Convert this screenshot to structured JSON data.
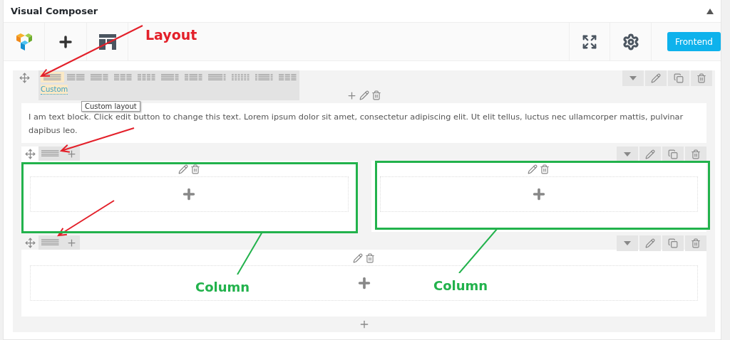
{
  "panel": {
    "title": "Visual Composer",
    "collapsed": false
  },
  "toolbar": {
    "frontend_button": "Frontend"
  },
  "rows": [
    {
      "layout_picker_open": true,
      "layout_options": [
        {
          "selected": true
        },
        {
          "selected": false
        },
        {
          "selected": false
        },
        {
          "selected": false
        },
        {
          "selected": false
        },
        {
          "selected": false
        },
        {
          "selected": false
        },
        {
          "selected": false
        },
        {
          "selected": false
        },
        {
          "selected": false
        },
        {
          "selected": false
        }
      ],
      "custom_link": "Custom",
      "tooltip": "Custom layout",
      "columns": [
        {
          "kind": "text_block",
          "text": "I am text block. Click edit button to change this text. Lorem ipsum dolor sit amet, consectetur adipiscing elit. Ut elit tellus, luctus nec ullamcorper mattis, pulvinar dapibus leo."
        }
      ]
    },
    {
      "layout_picker_open": false,
      "columns": [
        {
          "kind": "empty"
        },
        {
          "kind": "empty"
        }
      ]
    },
    {
      "layout_picker_open": false,
      "columns": [
        {
          "kind": "empty"
        }
      ]
    }
  ],
  "annotations": {
    "layout_label": "Layout",
    "column_labels": [
      "Column",
      "Column"
    ]
  }
}
